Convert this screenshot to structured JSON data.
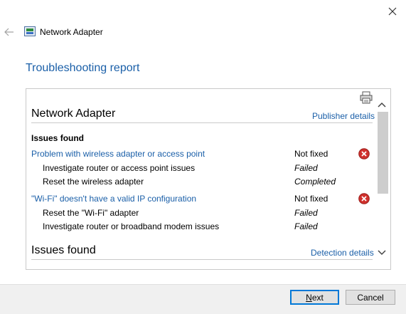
{
  "window": {
    "close_glyph": "✕",
    "back_glyph": "←",
    "app_icon": "network-adapter-icon",
    "title": "Network Adapter"
  },
  "report": {
    "title": "Troubleshooting report",
    "print_icon": "printer-icon",
    "section1": {
      "heading": "Network Adapter",
      "link": "Publisher details",
      "subheading": "Issues found",
      "issues": [
        {
          "label": "Problem with wireless adapter or access point",
          "status": "Not fixed",
          "steps": [
            {
              "label": "Investigate router or access point issues",
              "result": "Failed"
            },
            {
              "label": "Reset the wireless adapter",
              "result": "Completed"
            }
          ]
        },
        {
          "label": "\"Wi-Fi\" doesn't have a valid IP configuration",
          "status": "Not fixed",
          "steps": [
            {
              "label": "Reset the \"Wi-Fi\" adapter",
              "result": "Failed"
            },
            {
              "label": "Investigate router or broadband modem issues",
              "result": "Failed"
            }
          ]
        }
      ]
    },
    "section2": {
      "heading": "Issues found",
      "link": "Detection details"
    }
  },
  "footer": {
    "next_label": "Next",
    "next_mnemonic": "N",
    "next_rest": "ext",
    "cancel_label": "Cancel"
  },
  "colors": {
    "link": "#1a5fa8",
    "error_red": "#d0312d",
    "focus_border": "#0078d7"
  }
}
